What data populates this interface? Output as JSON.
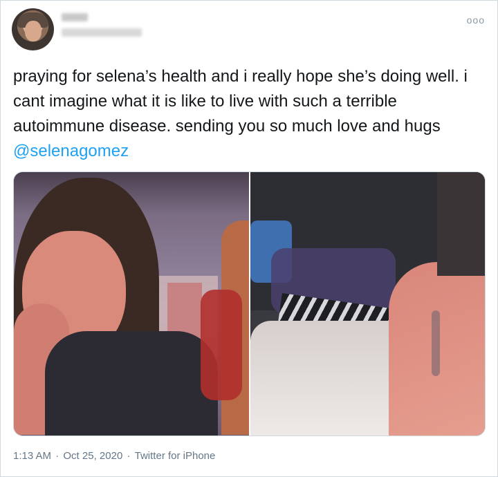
{
  "tweet": {
    "more_glyph": "ooo",
    "text_main": "praying for selena’s health and i really hope she’s doing well. i cant imagine what it is like to live with such a terrible autoimmune disease. sending you so much love and hugs ",
    "mention": "@selenagomez",
    "timestamp_time": "1:13 AM",
    "separator": " · ",
    "timestamp_date": "Oct 25, 2020",
    "source": "Twitter for iPhone"
  },
  "colors": {
    "accent": "#1da1f2",
    "text": "#14171a",
    "muted": "#657786",
    "border": "#cfd9de"
  }
}
